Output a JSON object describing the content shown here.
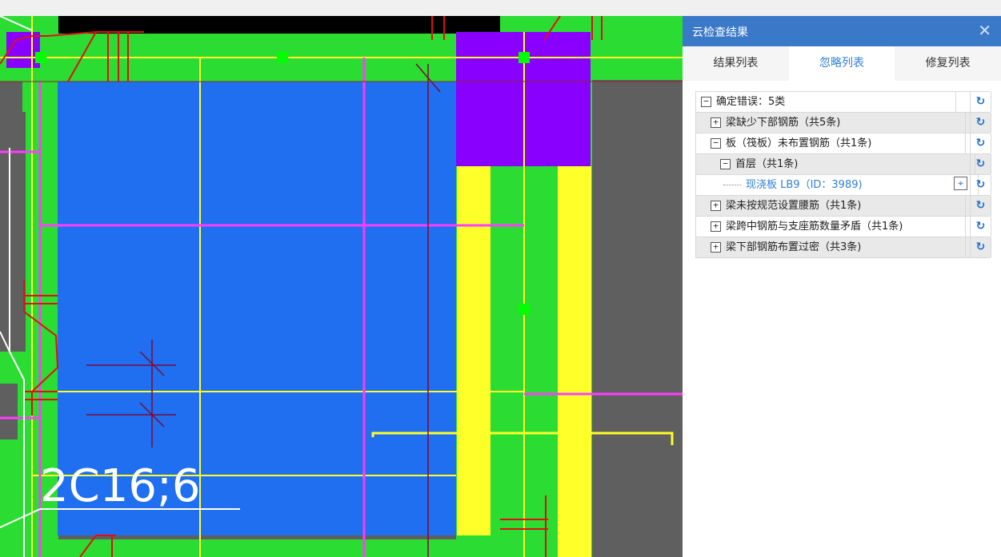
{
  "panel": {
    "title": "云检查结果",
    "close_label": "✕",
    "tabs": [
      {
        "label": "结果列表",
        "active": false
      },
      {
        "label": "忽略列表",
        "active": true
      },
      {
        "label": "修复列表",
        "active": false
      }
    ]
  },
  "tree": {
    "rows": [
      {
        "toggle": "−",
        "label": "确定错误：5类",
        "level": 0,
        "shaded": false,
        "undo_icon": "↻"
      },
      {
        "toggle": "+",
        "label": "梁缺少下部钢筋（共5条)",
        "level": 1,
        "shaded": true,
        "undo_icon": "↻"
      },
      {
        "toggle": "−",
        "label": "板（筏板）未布置钢筋（共1条)",
        "level": 1,
        "shaded": false,
        "undo_icon": "↻"
      },
      {
        "toggle": "−",
        "label": "首层（共1条)",
        "level": 2,
        "shaded": true,
        "undo_icon": "↻"
      },
      {
        "toggle": "",
        "label": "现浇板 LB9（ID：3989)",
        "level": 3,
        "shaded": false,
        "is_leaf": true,
        "locate_icon": "⌖",
        "undo_icon": "↻"
      },
      {
        "toggle": "+",
        "label": "梁未按规范设置腰筋（共1条)",
        "level": 1,
        "shaded": true,
        "undo_icon": "↻"
      },
      {
        "toggle": "+",
        "label": "梁跨中钢筋与支座筋数量矛盾（共1条)",
        "level": 1,
        "shaded": false,
        "undo_icon": "↻"
      },
      {
        "toggle": "+",
        "label": "梁下部钢筋布置过密（共3条)",
        "level": 1,
        "shaded": true,
        "undo_icon": "↻"
      }
    ]
  },
  "cad": {
    "annotation_text": "2C16;6",
    "colors": {
      "background": "#5f5f5f",
      "slab": "#1f6ff0",
      "beam": "#2bdc33",
      "column": "#8a00ff",
      "highlight": "#ffff2a",
      "rebar": "#e01010",
      "axis": "#ff3cff",
      "text": "#ffffff"
    }
  },
  "colors": {
    "header_blue": "#3a78c8",
    "tab_active": "#2f7fd6",
    "icon_blue": "#1e6fd0"
  }
}
